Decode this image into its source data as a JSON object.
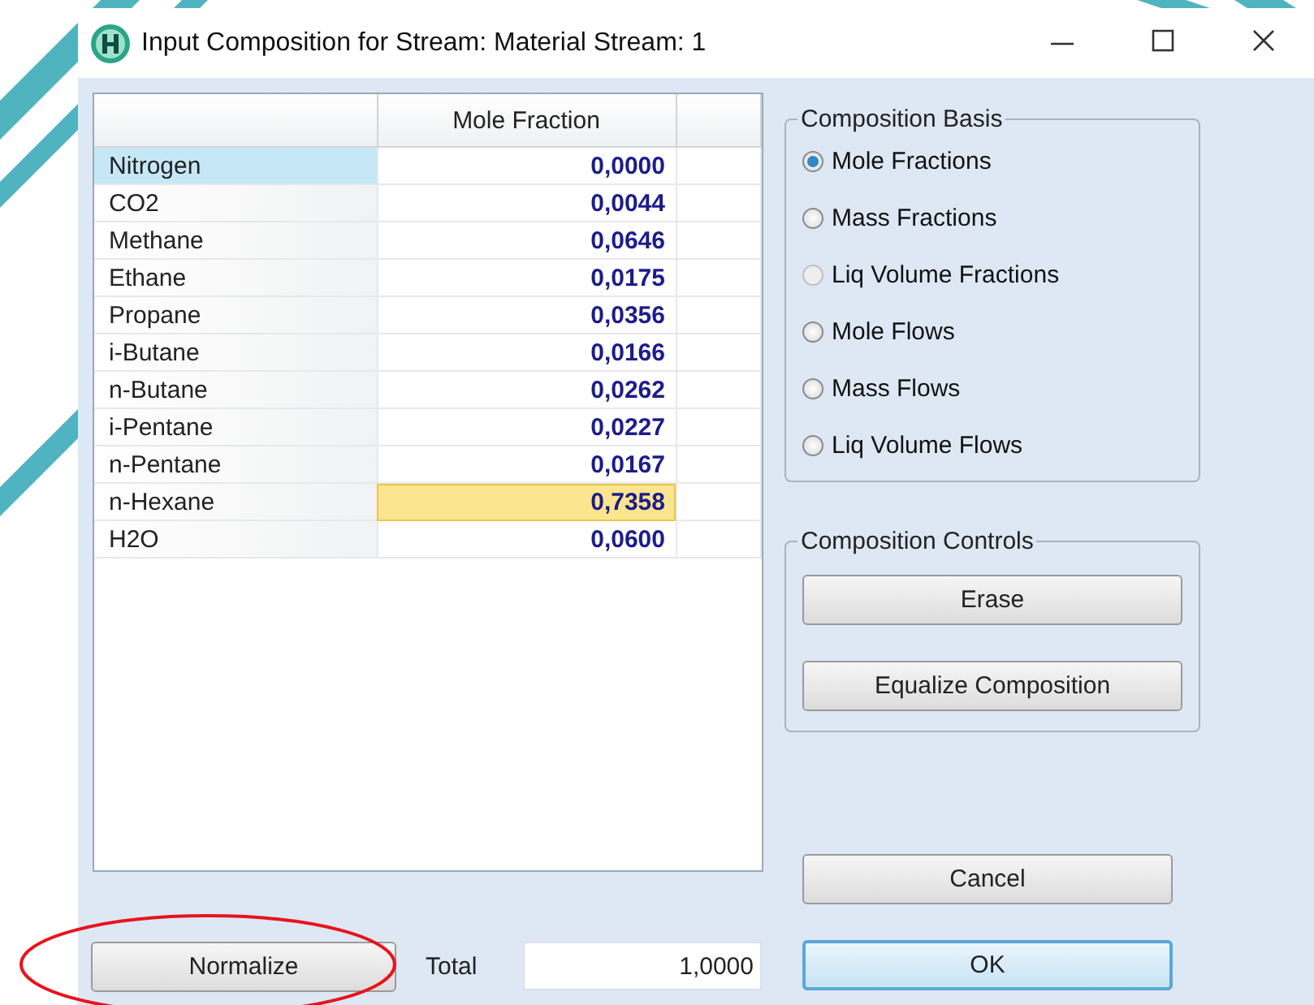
{
  "window": {
    "title": "Input Composition for Stream: Material Stream: 1"
  },
  "table": {
    "columns": [
      "Mole Fraction"
    ],
    "rows": [
      {
        "name": "Nitrogen",
        "value": "0,0000",
        "selected": true,
        "active": false
      },
      {
        "name": "CO2",
        "value": "0,0044",
        "selected": false,
        "active": false
      },
      {
        "name": "Methane",
        "value": "0,0646",
        "selected": false,
        "active": false
      },
      {
        "name": "Ethane",
        "value": "0,0175",
        "selected": false,
        "active": false
      },
      {
        "name": "Propane",
        "value": "0,0356",
        "selected": false,
        "active": false
      },
      {
        "name": "i-Butane",
        "value": "0,0166",
        "selected": false,
        "active": false
      },
      {
        "name": "n-Butane",
        "value": "0,0262",
        "selected": false,
        "active": false
      },
      {
        "name": "i-Pentane",
        "value": "0,0227",
        "selected": false,
        "active": false
      },
      {
        "name": "n-Pentane",
        "value": "0,0167",
        "selected": false,
        "active": false
      },
      {
        "name": "n-Hexane",
        "value": "0,7358",
        "selected": false,
        "active": true
      },
      {
        "name": "H2O",
        "value": "0,0600",
        "selected": false,
        "active": false
      }
    ]
  },
  "composition_basis": {
    "title": "Composition Basis",
    "options": [
      {
        "label": "Mole Fractions",
        "selected": true,
        "disabled": false
      },
      {
        "label": "Mass Fractions",
        "selected": false,
        "disabled": false
      },
      {
        "label": "Liq Volume Fractions",
        "selected": false,
        "disabled": true
      },
      {
        "label": "Mole Flows",
        "selected": false,
        "disabled": false
      },
      {
        "label": "Mass Flows",
        "selected": false,
        "disabled": false
      },
      {
        "label": "Liq Volume Flows",
        "selected": false,
        "disabled": false
      }
    ]
  },
  "composition_controls": {
    "title": "Composition Controls",
    "buttons": [
      "Erase",
      "Equalize Composition"
    ]
  },
  "normalize_button": "Normalize",
  "total": {
    "label": "Total",
    "value": "1,0000"
  },
  "buttons": [
    {
      "label": "Cancel",
      "default": false
    },
    {
      "label": "OK",
      "default": true
    }
  ],
  "annotations": [
    {
      "kind": "ellipse"
    }
  ]
}
